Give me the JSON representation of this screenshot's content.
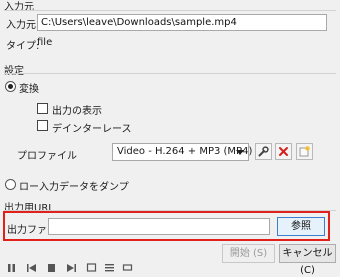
{
  "source": {
    "section_label": "入力元",
    "input_label": "入力元:",
    "input_value": "C:\\Users\\leave\\Downloads\\sample.mp4",
    "type_label": "タイプ:",
    "type_value": "file"
  },
  "settings": {
    "section_label": "設定",
    "convert_label": "変換",
    "show_output_label": "出力の表示",
    "deinterlace_label": "デインターレース",
    "profile_label": "プロファイル",
    "profile_value": "Video - H.264 + MP3 (MP4)",
    "dump_raw_label": "ロー入力データをダンプ"
  },
  "output": {
    "section_label": "出力用URL",
    "file_label": "出力ファイル:",
    "file_value": "",
    "browse_label": "参照"
  },
  "footer": {
    "start_label": "開始 (S)",
    "cancel_label": "キャンセル (C)"
  },
  "colors": {
    "highlight": "#e0201a",
    "accent": "#3c7fd1",
    "delete_red": "#d42020"
  },
  "icons": {
    "edit_profile": "wrench-icon",
    "delete_profile": "red-x-icon",
    "new_profile": "new-profile-icon"
  }
}
